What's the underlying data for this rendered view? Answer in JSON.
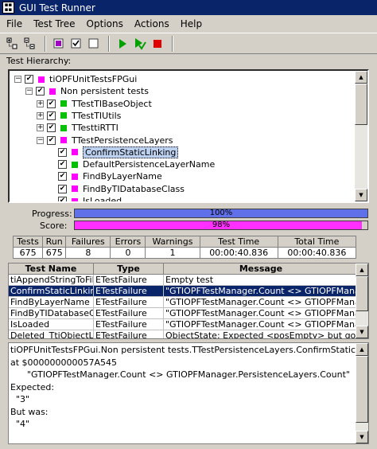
{
  "window": {
    "title": "GUI Test Runner",
    "icon": "app-icon"
  },
  "menu": [
    "File",
    "Test Tree",
    "Options",
    "Actions",
    "Help"
  ],
  "toolbar": {
    "icons": [
      "expand-tree-icon",
      "collapse-tree-icon",
      "select-all-icon",
      "check-all-icon",
      "uncheck-all-icon",
      "run-icon",
      "run-selected-icon",
      "stop-icon"
    ]
  },
  "labels": {
    "hierarchy": "Test Hierarchy:",
    "progress": "Progress:",
    "score": "Score:"
  },
  "tree": {
    "items": [
      {
        "label": "tiOPFUnitTestsFPGui",
        "level": 0,
        "expander": "−",
        "checked": true,
        "color": "#ff00ff"
      },
      {
        "label": "Non persistent tests",
        "level": 1,
        "expander": "−",
        "checked": true,
        "color": "#ff00ff"
      },
      {
        "label": "TTestTIBaseObject",
        "level": 2,
        "expander": "+",
        "checked": true,
        "color": "#00c000"
      },
      {
        "label": "TTestTIUtils",
        "level": 2,
        "expander": "+",
        "checked": true,
        "color": "#00c000"
      },
      {
        "label": "TTesttiRTTI",
        "level": 2,
        "expander": "+",
        "checked": true,
        "color": "#00c000"
      },
      {
        "label": "TTestPersistenceLayers",
        "level": 2,
        "expander": "−",
        "checked": true,
        "color": "#ff00ff"
      },
      {
        "label": "ConfirmStaticLinking",
        "level": 3,
        "expander": "",
        "checked": true,
        "color": "#ff00ff",
        "selected": true
      },
      {
        "label": "DefaultPersistenceLayerName",
        "level": 3,
        "expander": "",
        "checked": true,
        "color": "#00c000"
      },
      {
        "label": "FindByLayerName",
        "level": 3,
        "expander": "",
        "checked": true,
        "color": "#ff00ff"
      },
      {
        "label": "FindByTIDatabaseClass",
        "level": 3,
        "expander": "",
        "checked": true,
        "color": "#ff00ff"
      },
      {
        "label": "IsLoaded",
        "level": 3,
        "expander": "",
        "checked": true,
        "color": "#ff00ff"
      }
    ]
  },
  "progress": {
    "value": 1.0,
    "text": "100%",
    "color": "#6070e8"
  },
  "score": {
    "value": 0.98,
    "text": "98%",
    "color": "#ff30ff"
  },
  "stats": {
    "headers": [
      "Tests",
      "Run",
      "Failures",
      "Errors",
      "Warnings",
      "Test Time",
      "Total Time"
    ],
    "values": [
      "675",
      "675",
      "8",
      "0",
      "1",
      "00:00:40.836",
      "00:00:40.836"
    ]
  },
  "results": {
    "headers": [
      "Test Name",
      "Type",
      "Message"
    ],
    "rows": [
      [
        "tiAppendStringToFile",
        "ETestFailure",
        "Empty test"
      ],
      [
        "ConfirmStaticLinking",
        "ETestFailure",
        "    \"GTIOPFTestManager.Count <> GTIOPFManager"
      ],
      [
        "FindByLayerName",
        "ETestFailure",
        "    \"GTIOPFTestManager.Count <> GTIOPFManager"
      ],
      [
        "FindByTIDatabaseClass",
        "ETestFailure",
        "    \"GTIOPFTestManager.Count <> GTIOPFManager"
      ],
      [
        "IsLoaded",
        "ETestFailure",
        "    \"GTIOPFTestManager.Count <> GTIOPFManager"
      ],
      [
        "Deleted_TtiObjectList",
        "ETestFailure",
        "ObjectState: Expected <posEmpty> but got <posDele"
      ]
    ],
    "selected_index": 1
  },
  "details": [
    "tiOPFUnitTestsFPGui.Non persistent tests.TTestPersistenceLayers.ConfirmStaticLinking: ET",
    "at $000000000057A545",
    "      \"GTIOPFTestManager.Count <> GTIOPFManager.PersistenceLayers.Count\"",
    "Expected:",
    "  \"3\"",
    "But was:",
    "  \"4\""
  ]
}
